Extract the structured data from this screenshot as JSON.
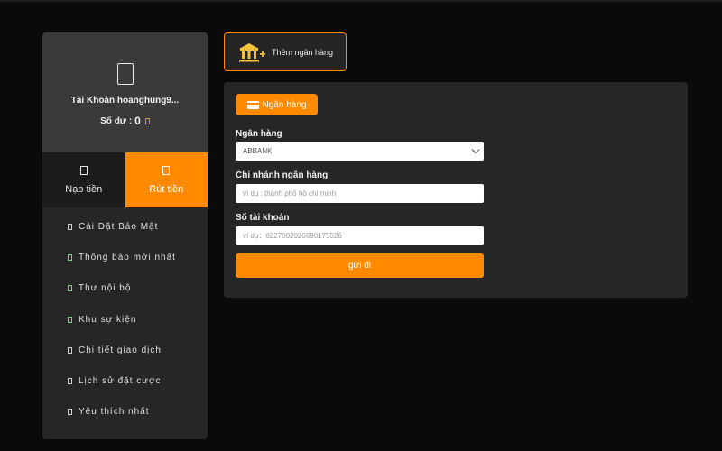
{
  "sidebar": {
    "account_label": "Tài Khoản hoanghung9...",
    "balance_label": "Số dư :",
    "balance_value": "0",
    "actions": {
      "deposit": "Nạp tiền",
      "withdraw": "Rút tiền"
    },
    "menu": [
      {
        "label": "Cài Đặt Bảo Mật"
      },
      {
        "label": "Thông báo mới nhất"
      },
      {
        "label": "Thư nội bộ"
      },
      {
        "label": "Khu sự kiện"
      },
      {
        "label": "Chi tiết giao dịch"
      },
      {
        "label": "Lịch sử đặt cược"
      },
      {
        "label": "Yêu thích nhất"
      }
    ]
  },
  "add_bank": {
    "label": "Thêm ngân hàng",
    "icon": "bank-plus-icon"
  },
  "form": {
    "tab_label": "Ngân hàng",
    "bank": {
      "label": "Ngân hàng",
      "value": "ABBANK"
    },
    "branch": {
      "label": "Chi nhánh ngân hàng",
      "placeholder": "ví dụ : thành phố hồ chí minh"
    },
    "account_number": {
      "label": "Số tài khoản",
      "placeholder": "ví dụ：6227002020690175526"
    },
    "submit_label": "gửi đi"
  },
  "colors": {
    "accent": "#ff8a00",
    "background": "#0a0a0a",
    "panel": "#262626",
    "profile": "#3a3a3a"
  }
}
